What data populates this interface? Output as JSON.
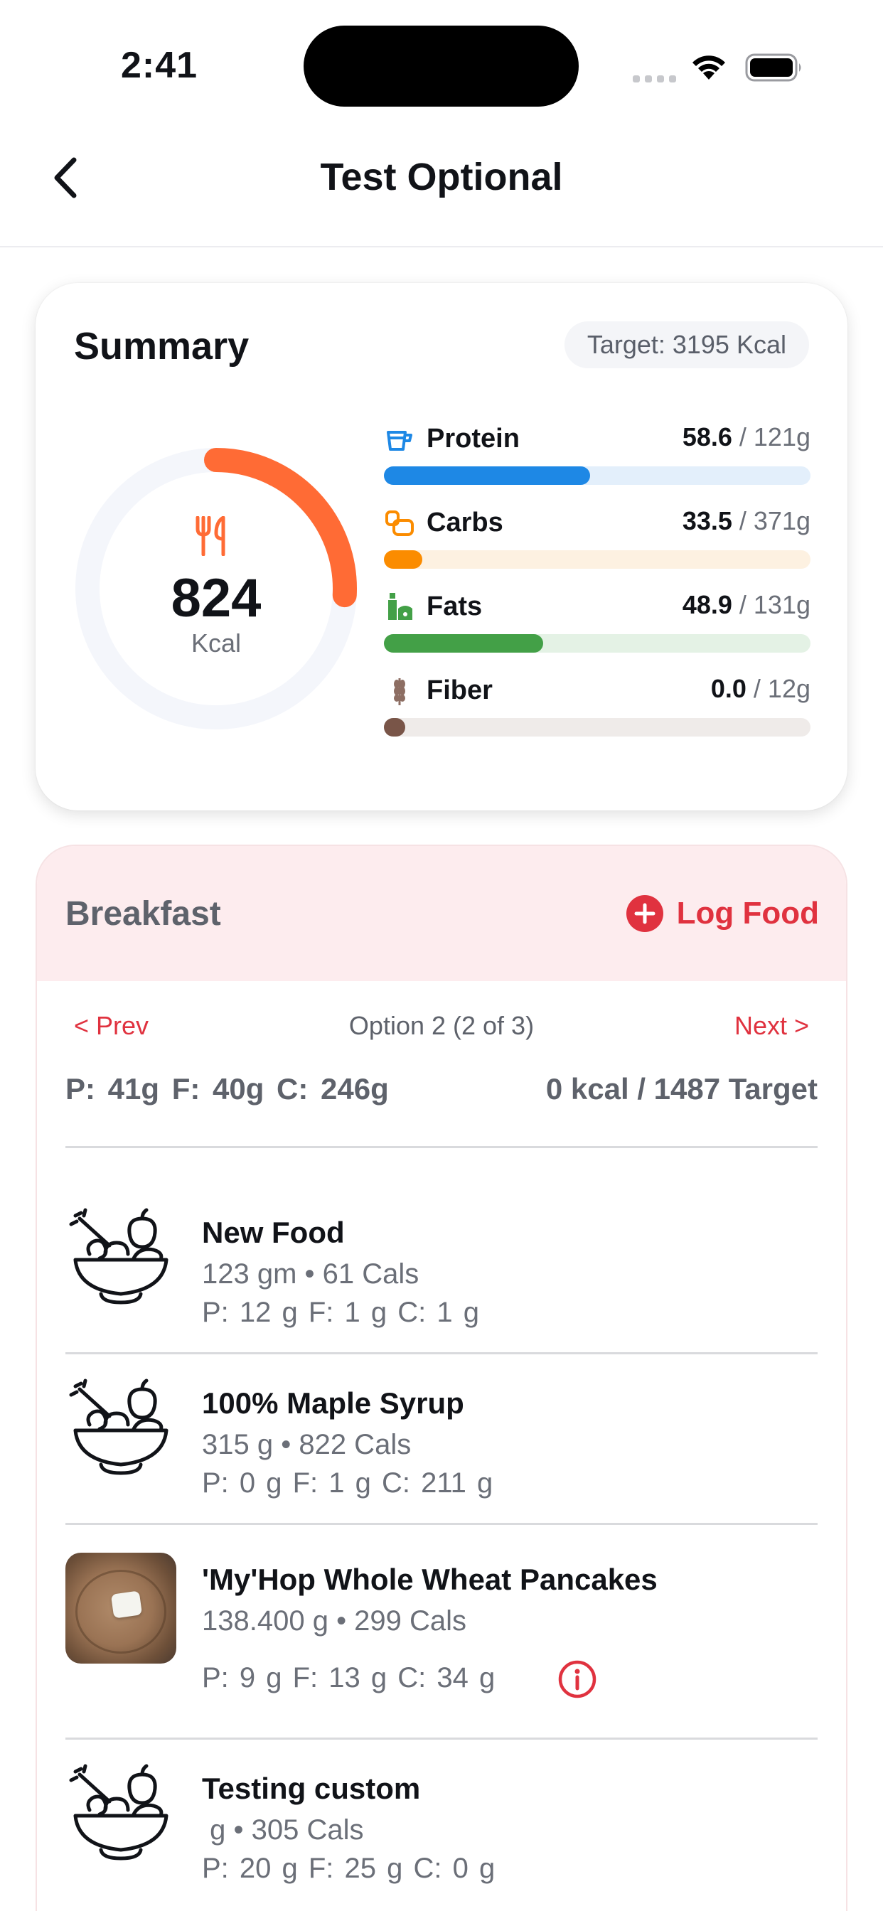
{
  "status_bar": {
    "time": "2:41"
  },
  "nav": {
    "title": "Test Optional"
  },
  "summary": {
    "title": "Summary",
    "target": "Target: 3195 Kcal",
    "calories": {
      "value": "824",
      "unit": "Kcal",
      "progress_fraction": 0.258
    },
    "macros": [
      {
        "name": "Protein",
        "value": "58.6",
        "target": "/ 121g",
        "fraction": 0.484,
        "color": "#1e88e5",
        "track": "#e3effb",
        "icon": "protein-icon"
      },
      {
        "name": "Carbs",
        "value": "33.5",
        "target": "/ 371g",
        "fraction": 0.09,
        "color": "#fb8c00",
        "track": "#fdf1e1",
        "icon": "carbs-icon"
      },
      {
        "name": "Fats",
        "value": "48.9",
        "target": "/ 131g",
        "fraction": 0.373,
        "color": "#43a047",
        "track": "#e4f2e5",
        "icon": "fats-icon"
      },
      {
        "name": "Fiber",
        "value": "0.0",
        "target": "/ 12g",
        "fraction": 0.0,
        "color": "#795548",
        "track": "#efebe9",
        "icon": "fiber-icon"
      }
    ],
    "ring_color": "#ff6b35"
  },
  "meal": {
    "title": "Breakfast",
    "log_label": "Log Food",
    "prev": "< Prev",
    "option": "Option 2 (2 of 3)",
    "next": "Next >",
    "totals_macros": "P: 41g F: 40g C: 246g",
    "totals_kcal": "0 kcal / 1487 Target",
    "accent": "#e0323f",
    "foods": [
      {
        "name": "New Food",
        "meta": "123 gm • 61 Cals",
        "macros": "P: 12 g  F: 1 g  C: 1 g",
        "icon": "food-bowl-icon"
      },
      {
        "name": "100% Maple Syrup",
        "meta": "315 g • 822 Cals",
        "macros": "P: 0 g  F: 1 g  C: 211 g",
        "icon": "food-bowl-icon"
      },
      {
        "name": "'My'Hop Whole Wheat Pancakes",
        "meta": "138.400 g • 299 Cals",
        "macros": "P: 9 g  F: 13 g  C: 34 g",
        "icon": "pancake-photo"
      },
      {
        "name": "Testing custom",
        "meta": " g • 305 Cals",
        "macros": "P: 20 g  F: 25 g  C: 0 g",
        "icon": "food-bowl-icon"
      }
    ]
  }
}
